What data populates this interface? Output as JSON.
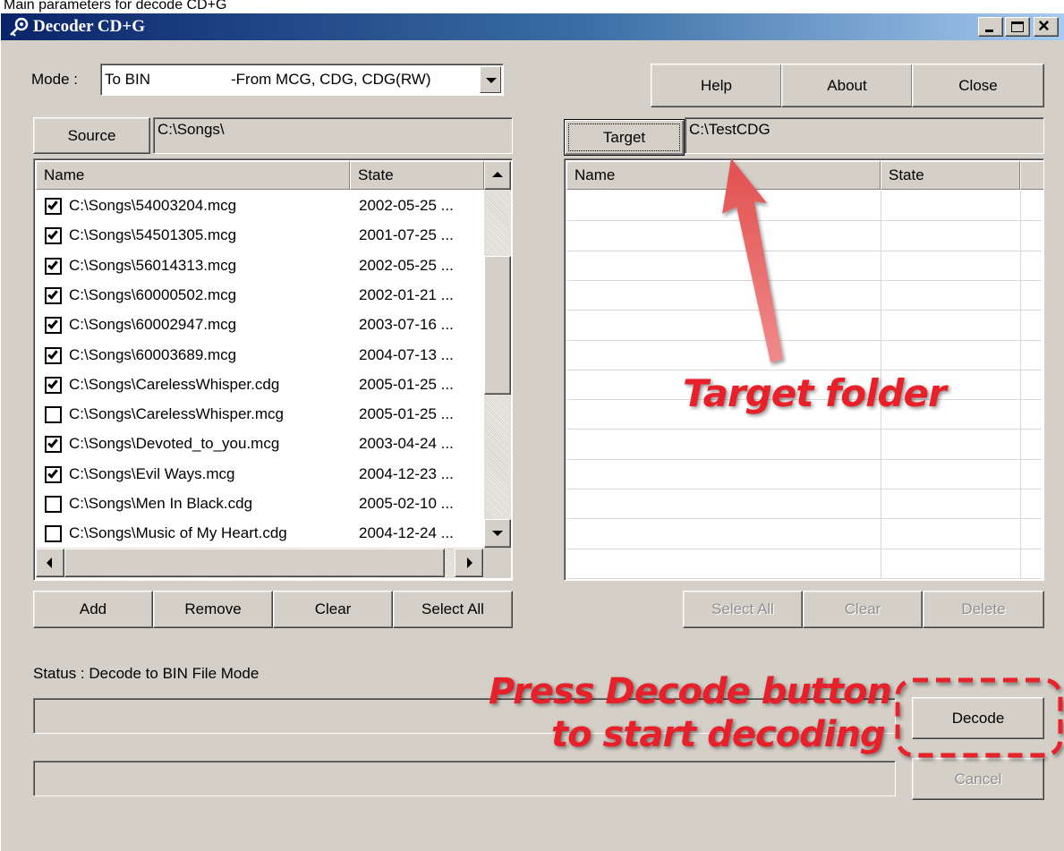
{
  "caption": "Main parameters for decode CD+G",
  "window": {
    "title": "Decoder CD+G",
    "minimize_glyph": "_",
    "maximize_glyph": "□",
    "close_glyph": "×"
  },
  "mode": {
    "label": "Mode :",
    "value_primary": "To BIN",
    "value_secondary": "-From MCG, CDG, CDG(RW)"
  },
  "top_buttons": {
    "help": "Help",
    "about": "About",
    "close": "Close"
  },
  "source": {
    "button": "Source",
    "path": "C:\\Songs\\"
  },
  "target": {
    "button": "Target",
    "path": "C:\\TestCDG"
  },
  "source_list": {
    "columns": [
      "Name",
      "State"
    ],
    "rows": [
      {
        "name": "C:\\Songs\\54003204.mcg",
        "state": "2002-05-25 ...",
        "checked": true
      },
      {
        "name": "C:\\Songs\\54501305.mcg",
        "state": "2001-07-25 ...",
        "checked": true
      },
      {
        "name": "C:\\Songs\\56014313.mcg",
        "state": "2002-05-25 ...",
        "checked": true
      },
      {
        "name": "C:\\Songs\\60000502.mcg",
        "state": "2002-01-21 ...",
        "checked": true
      },
      {
        "name": "C:\\Songs\\60002947.mcg",
        "state": "2003-07-16 ...",
        "checked": true
      },
      {
        "name": "C:\\Songs\\60003689.mcg",
        "state": "2004-07-13 ...",
        "checked": true
      },
      {
        "name": "C:\\Songs\\CarelessWhisper.cdg",
        "state": "2005-01-25 ...",
        "checked": true
      },
      {
        "name": "C:\\Songs\\CarelessWhisper.mcg",
        "state": "2005-01-25 ...",
        "checked": false
      },
      {
        "name": "C:\\Songs\\Devoted_to_you.mcg",
        "state": "2003-04-24 ...",
        "checked": true
      },
      {
        "name": "C:\\Songs\\Evil Ways.mcg",
        "state": "2004-12-23 ...",
        "checked": true
      },
      {
        "name": "C:\\Songs\\Men In Black.cdg",
        "state": "2005-02-10 ...",
        "checked": false
      },
      {
        "name": "C:\\Songs\\Music of My Heart.cdg",
        "state": "2004-12-24 ...",
        "checked": false
      }
    ]
  },
  "target_list": {
    "columns": [
      "Name",
      "State"
    ]
  },
  "source_buttons": {
    "add": "Add",
    "remove": "Remove",
    "clear": "Clear",
    "select_all": "Select All"
  },
  "target_buttons": {
    "select_all": "Select All",
    "clear": "Clear",
    "delete": "Delete"
  },
  "status": {
    "text": "Status : Decode to BIN File Mode"
  },
  "actions": {
    "decode": "Decode",
    "cancel": "Cancel"
  },
  "annotations": {
    "target_folder": "Target folder",
    "decode_line1": "Press Decode button",
    "decode_line2": "to start decoding",
    "color": "#e8202a"
  }
}
